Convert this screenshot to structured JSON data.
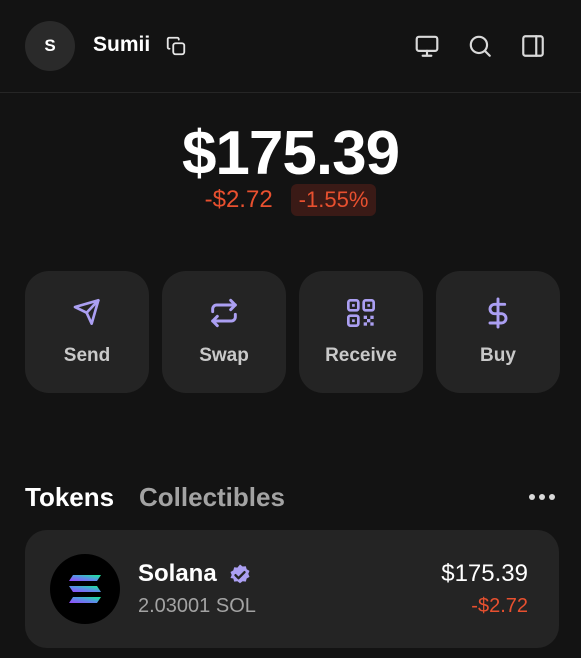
{
  "header": {
    "avatar_initial": "S",
    "account_name": "Sumii",
    "icons": [
      "copy-icon",
      "monitor-icon",
      "search-icon",
      "sidebar-icon"
    ]
  },
  "balance": {
    "total": "$175.39",
    "change_usd": "-$2.72",
    "change_pct": "-1.55%"
  },
  "actions": [
    {
      "label": "Send",
      "icon": "send-icon"
    },
    {
      "label": "Swap",
      "icon": "swap-icon"
    },
    {
      "label": "Receive",
      "icon": "qr-code-icon"
    },
    {
      "label": "Buy",
      "icon": "dollar-icon"
    }
  ],
  "tabs": {
    "tokens": "Tokens",
    "collectibles": "Collectibles",
    "active": "Tokens"
  },
  "tokens": [
    {
      "name": "Solana",
      "verified": true,
      "amount": "2.03001 SOL",
      "value": "$175.39",
      "change": "-$2.72"
    }
  ],
  "colors": {
    "background": "#131313",
    "card": "#242424",
    "accent": "#ab9ff2",
    "negative": "#e8502f",
    "muted_text": "#a3a3a3"
  }
}
